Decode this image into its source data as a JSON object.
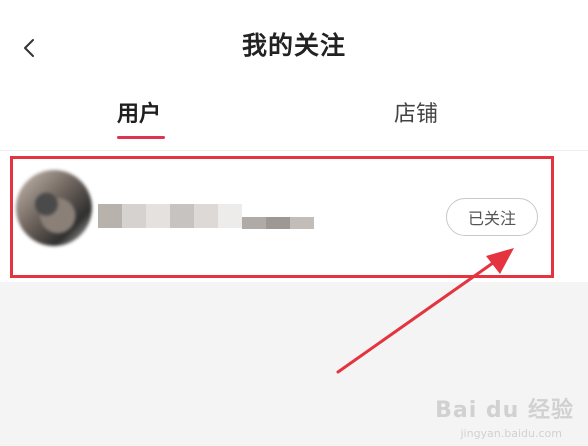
{
  "header": {
    "title": "我的关注",
    "back_icon": "chevron-left-icon"
  },
  "tabs": [
    {
      "label": "用户",
      "active": true
    },
    {
      "label": "店铺",
      "active": false
    }
  ],
  "accent_color": "#e0334f",
  "highlight_color": "#e4343f",
  "follow_list": [
    {
      "username": "",
      "button_label": "已关注"
    }
  ],
  "watermark": {
    "brand": "Bai du 经验",
    "sub": "jingyan.baidu.com"
  }
}
